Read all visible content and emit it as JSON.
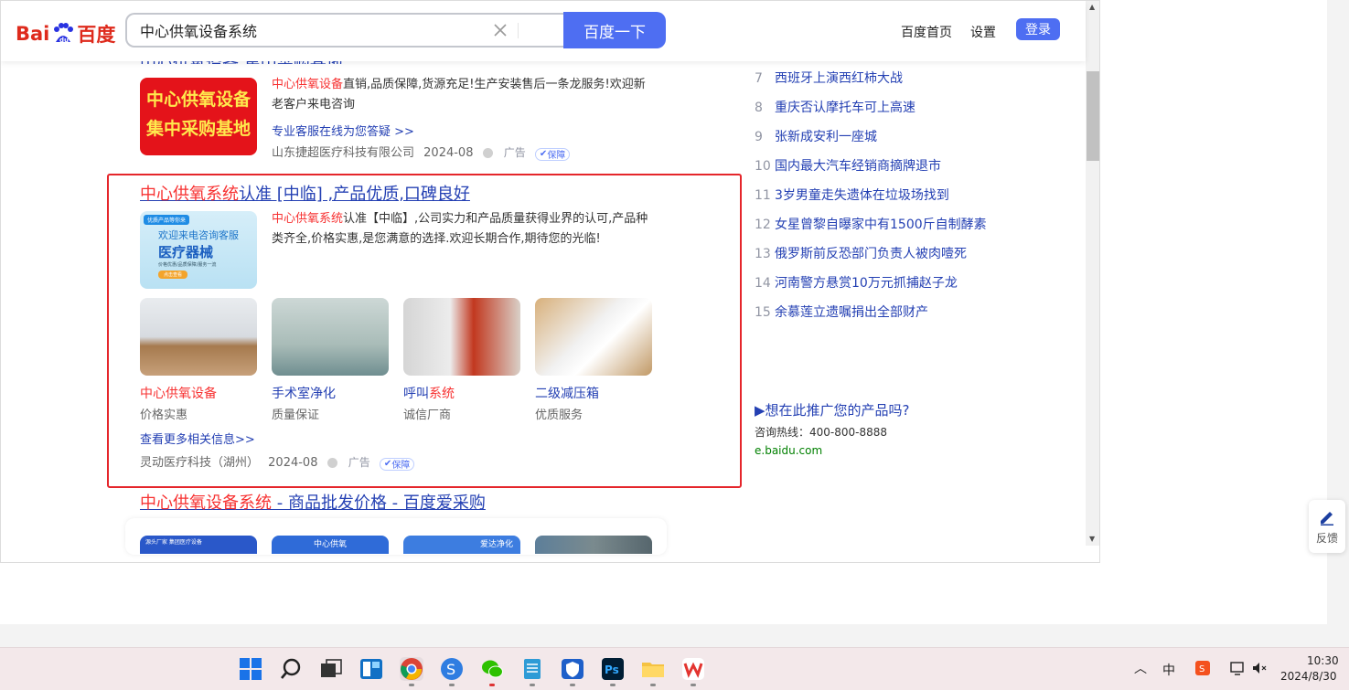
{
  "header": {
    "logo_text": "Bai百度",
    "search_value": "中心供氧设备系统",
    "search_button": "百度一下",
    "nav_home": "百度首页",
    "nav_settings": "设置",
    "login": "登录"
  },
  "ad1": {
    "partial_title": "中心供氧设备 集中采购基地",
    "img_line1": "中心供氧设备",
    "img_line2": "集中采购基地",
    "desc_red": "中心供氧设备",
    "desc_rest": "直销,品质保障,货源充足!生产安装售后一条龙服务!欢迎新老客户来电咨询",
    "link": "专业客服在线为您答疑 >>",
    "company": "山东捷超医疗科技有限公司",
    "date": "2024-08",
    "ad_label": "广告",
    "guard_label": "保障"
  },
  "ad2": {
    "title_red": "中心供氧系统",
    "title_rest": "认准 [中临] ,产品优质,口碑良好",
    "img_tag": "优质产品等你来",
    "img_line1": "欢迎来电咨询客服",
    "img_line2": "医疗器械",
    "img_line3": "价格优惠/品质保障/服务一流",
    "img_btn": "点击查看",
    "desc_red": "中心供氧系统",
    "desc_rest": "认准【中临】,公司实力和产品质量获得业界的认可,产品种类齐全,价格实惠,是您满意的选择.欢迎长期合作,期待您的光临!",
    "thumbs": [
      {
        "title_red": "中心供氧设备",
        "title_rest": "",
        "sub": "价格实惠"
      },
      {
        "title_red": "",
        "title_rest": "手术室净化",
        "sub": "质量保证"
      },
      {
        "title_red": "系统",
        "title_prefix": "呼叫",
        "title_rest": "",
        "sub": "诚信厂商"
      },
      {
        "title_red": "",
        "title_rest": "二级减压箱",
        "sub": "优质服务"
      }
    ],
    "more_link": "查看更多相关信息>>",
    "company": "灵动医疗科技（湖州）",
    "date": "2024-08",
    "ad_label": "广告",
    "guard_label": "保障"
  },
  "ad3": {
    "title_red": "中心供氧设备系统",
    "title_rest": " - 商品批发价格 - 百度爱采购",
    "partial_banner_1": "源头厂家  集团医疗设备",
    "partial_banner_2": "中心供氧",
    "partial_banner_3": "爱达净化"
  },
  "hot_list": [
    {
      "num": "7",
      "text": "西班牙上演西红柿大战"
    },
    {
      "num": "8",
      "text": "重庆否认摩托车可上高速"
    },
    {
      "num": "9",
      "text": "张新成安利一座城"
    },
    {
      "num": "10",
      "text": "国内最大汽车经销商摘牌退市"
    },
    {
      "num": "11",
      "text": "3岁男童走失遗体在垃圾场找到"
    },
    {
      "num": "12",
      "text": "女星曾黎自曝家中有1500斤自制酵素"
    },
    {
      "num": "13",
      "text": "俄罗斯前反恐部门负责人被肉噎死"
    },
    {
      "num": "14",
      "text": "河南警方悬赏10万元抓捕赵子龙"
    },
    {
      "num": "15",
      "text": "余慕莲立遗嘱捐出全部财产"
    }
  ],
  "promo": {
    "title": "▶想在此推广您的产品吗?",
    "hotline": "咨询热线：400-800-8888",
    "site": "e.baidu.com"
  },
  "feedback_label": "反馈",
  "taskbar": {
    "ime": "中",
    "time": "10:30",
    "date": "2024/8/30"
  }
}
